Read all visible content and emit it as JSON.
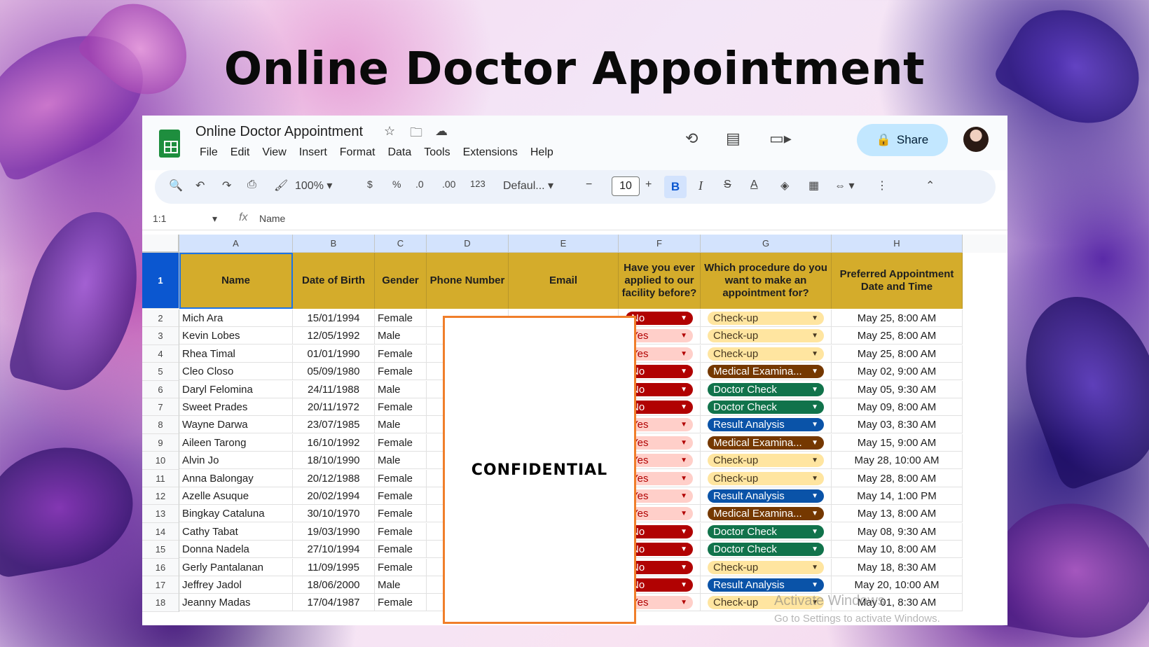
{
  "headline": "Online Doctor Appointment",
  "app": {
    "doc_title": "Online Doctor Appointment",
    "menu": [
      "File",
      "Edit",
      "View",
      "Insert",
      "Format",
      "Data",
      "Tools",
      "Extensions",
      "Help"
    ],
    "share_label": "Share"
  },
  "toolbar": {
    "zoom": "100%",
    "currency": "$",
    "percent": "%",
    "dec_decrease": ".0",
    "dec_increase": ".00",
    "number_format": "123",
    "font": "Defaul...",
    "font_size": "10",
    "bold": "B",
    "italic": "I"
  },
  "formula_bar": {
    "name_box": "1:1",
    "fx": "fx",
    "value": "Name"
  },
  "columns": [
    "A",
    "B",
    "C",
    "D",
    "E",
    "F",
    "G",
    "H"
  ],
  "headers": [
    "Name",
    "Date of Birth",
    "Gender",
    "Phone Number",
    "Email",
    "Have you ever applied to our facility before?",
    "Which procedure do you want to make an appointment for?",
    "Preferred Appointment Date and Time"
  ],
  "rows": [
    {
      "n": "2",
      "name": "Mich Ara",
      "dob": "15/01/1994",
      "gender": "Female",
      "applied": "No",
      "procedure": "Check-up",
      "date": "May 25, 8:00 AM"
    },
    {
      "n": "3",
      "name": "Kevin Lobes",
      "dob": "12/05/1992",
      "gender": "Male",
      "applied": "Yes",
      "procedure": "Check-up",
      "date": "May 25, 8:00 AM"
    },
    {
      "n": "4",
      "name": "Rhea Timal",
      "dob": "01/01/1990",
      "gender": "Female",
      "applied": "Yes",
      "procedure": "Check-up",
      "date": "May 25, 8:00 AM"
    },
    {
      "n": "5",
      "name": "Cleo Closo",
      "dob": "05/09/1980",
      "gender": "Female",
      "applied": "No",
      "procedure": "Medical Examina...",
      "date": "May 02, 9:00 AM"
    },
    {
      "n": "6",
      "name": "Daryl Felomina",
      "dob": "24/11/1988",
      "gender": "Male",
      "applied": "No",
      "procedure": "Doctor Check",
      "date": "May 05, 9:30 AM"
    },
    {
      "n": "7",
      "name": "Sweet Prades",
      "dob": "20/11/1972",
      "gender": "Female",
      "applied": "No",
      "procedure": "Doctor Check",
      "date": "May 09, 8:00 AM"
    },
    {
      "n": "8",
      "name": "Wayne Darwa",
      "dob": "23/07/1985",
      "gender": "Male",
      "applied": "Yes",
      "procedure": "Result Analysis",
      "date": "May 03, 8:30 AM"
    },
    {
      "n": "9",
      "name": "Aileen Tarong",
      "dob": "16/10/1992",
      "gender": "Female",
      "applied": "Yes",
      "procedure": "Medical Examina...",
      "date": "May 15, 9:00 AM"
    },
    {
      "n": "10",
      "name": "Alvin Jo",
      "dob": "18/10/1990",
      "gender": "Male",
      "applied": "Yes",
      "procedure": "Check-up",
      "date": "May 28, 10:00 AM"
    },
    {
      "n": "11",
      "name": "Anna Balongay",
      "dob": "20/12/1988",
      "gender": "Female",
      "applied": "Yes",
      "procedure": "Check-up",
      "date": "May 28, 8:00 AM"
    },
    {
      "n": "12",
      "name": "Azelle Asuque",
      "dob": "20/02/1994",
      "gender": "Female",
      "applied": "Yes",
      "procedure": "Result Analysis",
      "date": "May 14, 1:00 PM"
    },
    {
      "n": "13",
      "name": "Bingkay Cataluna",
      "dob": "30/10/1970",
      "gender": "Female",
      "applied": "Yes",
      "procedure": "Medical Examina...",
      "date": "May 13, 8:00 AM"
    },
    {
      "n": "14",
      "name": "Cathy Tabat",
      "dob": "19/03/1990",
      "gender": "Female",
      "applied": "No",
      "procedure": "Doctor Check",
      "date": "May 08, 9:30 AM"
    },
    {
      "n": "15",
      "name": "Donna Nadela",
      "dob": "27/10/1994",
      "gender": "Female",
      "applied": "No",
      "procedure": "Doctor Check",
      "date": "May 10, 8:00 AM"
    },
    {
      "n": "16",
      "name": "Gerly Pantalanan",
      "dob": "11/09/1995",
      "gender": "Female",
      "applied": "No",
      "procedure": "Check-up",
      "date": "May 18, 8:30 AM"
    },
    {
      "n": "17",
      "name": "Jeffrey Jadol",
      "dob": "18/06/2000",
      "gender": "Male",
      "applied": "No",
      "procedure": "Result Analysis",
      "date": "May 20, 10:00 AM"
    },
    {
      "n": "18",
      "name": "Jeanny Madas",
      "dob": "17/04/1987",
      "gender": "Female",
      "applied": "Yes",
      "procedure": "Check-up",
      "date": "May 01, 8:30 AM"
    }
  ],
  "chip_colors": {
    "No": {
      "bg": "#b10202",
      "fg": "#ffffff"
    },
    "Yes": {
      "bg": "#ffcfc9",
      "fg": "#b10202"
    },
    "Check-up": {
      "bg": "#ffe5a0",
      "fg": "#473821"
    },
    "Medical Examina...": {
      "bg": "#753800",
      "fg": "#ffffff"
    },
    "Doctor Check": {
      "bg": "#11734b",
      "fg": "#ffffff"
    },
    "Result Analysis": {
      "bg": "#0a53a8",
      "fg": "#ffffff"
    }
  },
  "confidential_label": "CONFIDENTIAL",
  "watermark": {
    "line1": "Activate Windows",
    "line2": "Go to Settings to activate Windows."
  }
}
